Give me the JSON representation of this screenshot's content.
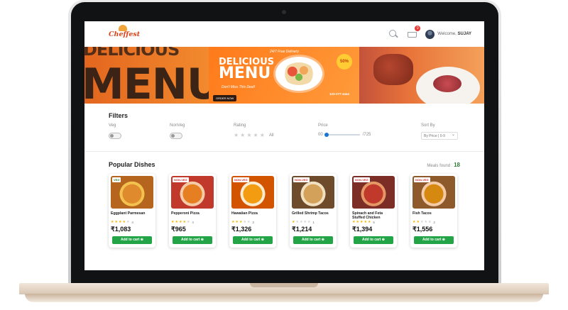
{
  "app": {
    "logo_text": "Cheffest",
    "welcome_prefix": "Welcome,",
    "user_name": "SUJAY",
    "cart_count": "0"
  },
  "banner": {
    "left_word_1": "DELICIOUS",
    "left_word_2": "MENU",
    "center_title_1": "DELICIOUS",
    "center_title_2": "MENU",
    "center_subtitle": "Don't Miss This Deal!",
    "center_order": "ORDER NOW",
    "center_delivery": "24/7 Free Delivery",
    "center_discount": "50%",
    "center_phone": "123-277-4444"
  },
  "filters": {
    "title": "Filters",
    "veg_label": "Veg",
    "nonveg_label": "NonVeg",
    "rating_label": "Rating",
    "rating_all": "All",
    "price_label": "Price",
    "price_min": "00",
    "price_max": "/725",
    "sort_label": "Sort By",
    "sort_value": "By Price | 0-9"
  },
  "dishes": {
    "title": "Popular Dishes",
    "meals_found_label": "Meals found :",
    "meals_found_count": "18",
    "add_label": "Add to cart",
    "items": [
      {
        "name": "Eggplant Parmesan",
        "tag": "VEG",
        "rating": 4,
        "rating_text": "4",
        "price": "₹1,083",
        "colors": [
          "#b5651d",
          "#e08a2e",
          "#f2c14e"
        ]
      },
      {
        "name": "Pepperoni Pizza",
        "tag": "NON-VEG",
        "rating": 4,
        "rating_text": "4",
        "price": "₹965",
        "colors": [
          "#c0392b",
          "#e67e22",
          "#f5cba7"
        ]
      },
      {
        "name": "Hawaiian Pizza",
        "tag": "NON-VEG",
        "rating": 3,
        "rating_text": "3",
        "price": "₹1,326",
        "colors": [
          "#d35400",
          "#f39c12",
          "#fdebd0"
        ]
      },
      {
        "name": "Grilled Shrimp Tacos",
        "tag": "NON-VEG",
        "rating": 1,
        "rating_text": "1",
        "price": "₹1,214",
        "colors": [
          "#6e4b2a",
          "#d4a15a",
          "#f0e0c0"
        ]
      },
      {
        "name": "Spinach and Feta Stuffed Chicken",
        "tag": "NON-VEG",
        "rating": 5,
        "rating_text": "5",
        "price": "₹1,394",
        "colors": [
          "#7b2d26",
          "#c0392b",
          "#e59866"
        ]
      },
      {
        "name": "Fish Tacos",
        "tag": "NON-VEG",
        "rating": 2,
        "rating_text": "2",
        "price": "₹1,556",
        "colors": [
          "#8e5a2b",
          "#d68910",
          "#f5cba7"
        ]
      }
    ],
    "next_row_tags": [
      "",
      "VEG",
      "",
      "NON-VEG",
      "NON-VEG",
      "NON-VEG"
    ]
  }
}
